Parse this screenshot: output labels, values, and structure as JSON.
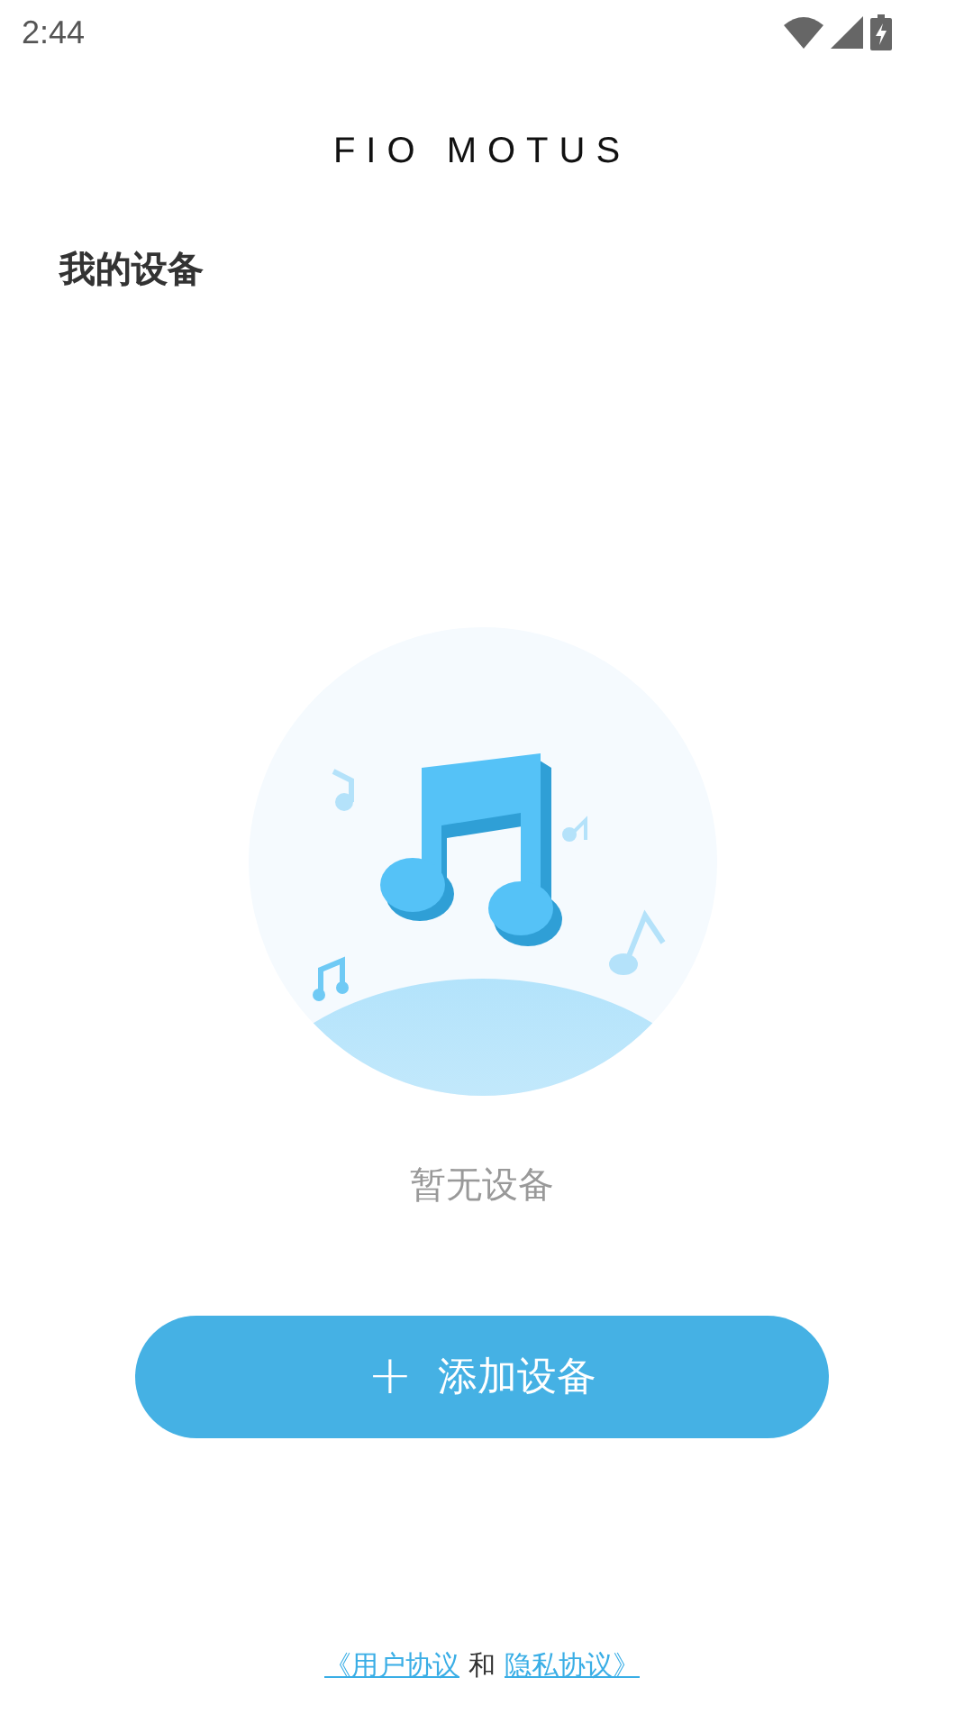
{
  "status_bar": {
    "time": "2:44"
  },
  "logo": "FIO MOTUS",
  "section_title": "我的设备",
  "empty_state": {
    "message": "暂无设备"
  },
  "add_button": {
    "icon": "+",
    "label": "添加设备"
  },
  "footer": [
    {
      "kind": "link",
      "text": "《用户协议"
    },
    {
      "kind": "text",
      "text": "和"
    },
    {
      "kind": "link",
      "text": "隐私协议》"
    }
  ]
}
